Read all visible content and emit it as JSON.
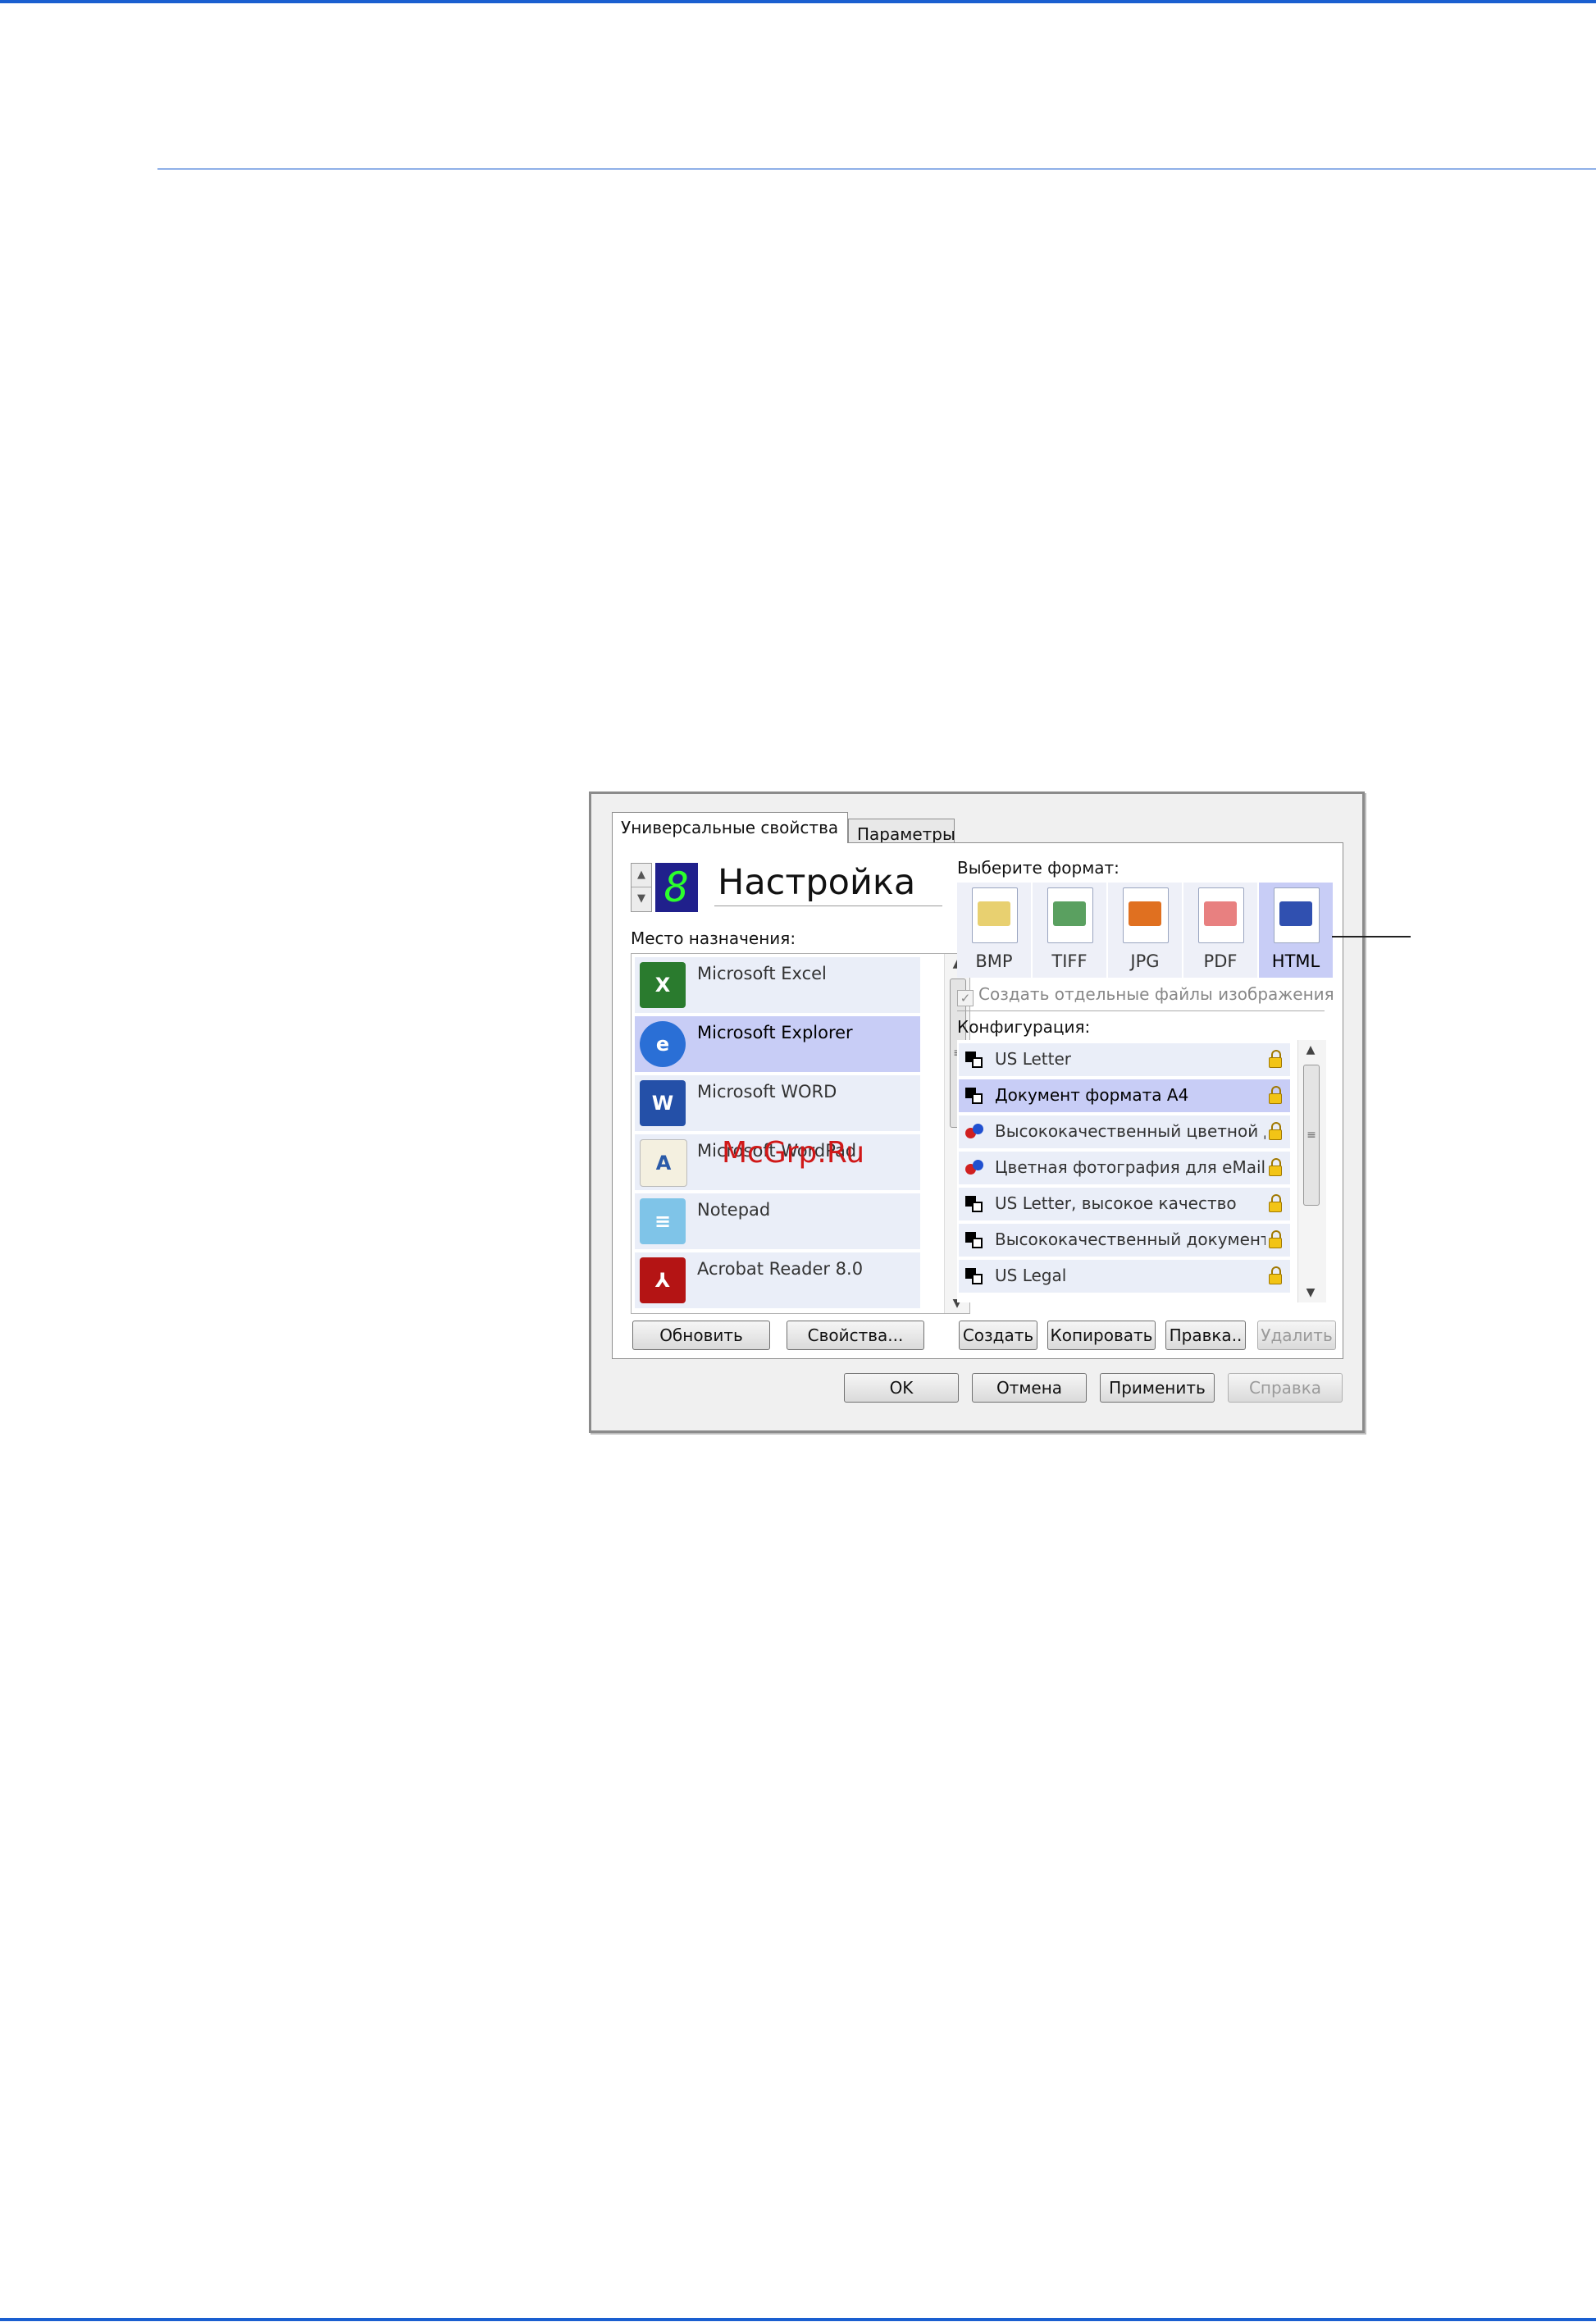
{
  "dialog": {
    "tabs": [
      {
        "label": "Универсальные свойства",
        "active": true
      },
      {
        "label": "Параметры",
        "active": false
      }
    ],
    "profile": {
      "digit": "8",
      "name": "Настройка"
    },
    "destination": {
      "label": "Место назначения:",
      "items": [
        {
          "label": "Microsoft Excel",
          "icon": "excel-icon",
          "selected": false
        },
        {
          "label": "Microsoft Explorer",
          "icon": "internet-explorer-icon",
          "selected": true
        },
        {
          "label": "Microsoft WORD",
          "icon": "word-icon",
          "selected": false
        },
        {
          "label": "Microsoft WordPad",
          "icon": "wordpad-icon",
          "selected": false
        },
        {
          "label": "Notepad",
          "icon": "notepad-icon",
          "selected": false
        },
        {
          "label": "Acrobat Reader 8.0",
          "icon": "acrobat-icon",
          "selected": false
        }
      ],
      "refresh_button": "Обновить",
      "properties_button": "Свойства..."
    },
    "format": {
      "label": "Выберите формат:",
      "options": [
        {
          "label": "BMP",
          "icon": "bmp-icon",
          "selected": false
        },
        {
          "label": "TIFF",
          "icon": "tiff-icon",
          "selected": false
        },
        {
          "label": "JPG",
          "icon": "jpg-icon",
          "selected": false
        },
        {
          "label": "PDF",
          "icon": "pdf-icon",
          "selected": false
        },
        {
          "label": "HTML",
          "icon": "html-icon",
          "selected": true
        }
      ],
      "separate_files_checkbox": "Создать отдельные файлы изображения",
      "separate_files_checked": true,
      "separate_files_disabled": true
    },
    "configuration": {
      "label": "Конфигурация:",
      "items": [
        {
          "label": "US Letter",
          "icon": "bw-document-icon",
          "selected": false
        },
        {
          "label": "Документ формата A4",
          "icon": "bw-document-icon",
          "selected": true
        },
        {
          "label": "Высококачественный цветной д...",
          "icon": "color-document-icon",
          "selected": false
        },
        {
          "label": "Цветная фотография для eMail (6...",
          "icon": "color-document-icon",
          "selected": false
        },
        {
          "label": "US Letter, высокое качество",
          "icon": "bw-document-icon",
          "selected": false
        },
        {
          "label": "Высококачественный документ ...",
          "icon": "bw-document-icon",
          "selected": false
        },
        {
          "label": "US Legal",
          "icon": "bw-document-icon",
          "selected": false
        }
      ],
      "create_button": "Создать",
      "copy_button": "Копировать",
      "edit_button": "Правка..",
      "delete_button": "Удалить"
    },
    "footer": {
      "ok_button": "OK",
      "cancel_button": "Отмена",
      "apply_button": "Применить",
      "help_button": "Справка"
    }
  },
  "watermark": "McGrp.Ru",
  "colors": {
    "accent_line": "#1a5fd0",
    "selection": "#c8cdf6",
    "watermark": "#d01818"
  }
}
